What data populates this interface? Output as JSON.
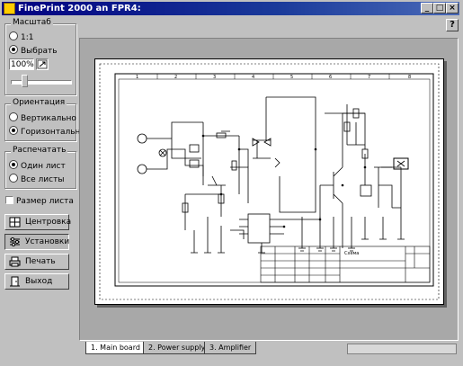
{
  "window": {
    "title": "FinePrint 2000 an FPR4:",
    "min_label": "_",
    "max_label": "□",
    "close_label": "×"
  },
  "help_label": "?",
  "scale_group": {
    "title": "Масштаб",
    "opt1": "1:1",
    "opt2": "Выбрать",
    "zoom_value": "100%",
    "selected": "opt2"
  },
  "orientation_group": {
    "title": "Ориентация",
    "opt1": "Вертикально",
    "opt2": "Горизонтально",
    "selected": "opt2"
  },
  "print_group": {
    "title": "Распечатать",
    "opt1": "Один лист",
    "opt2": "Все листы",
    "selected": "opt1"
  },
  "sheet_size_label": "Размер листа",
  "buttons": {
    "center": "Центровка",
    "settings": "Установки",
    "print": "Печать",
    "exit": "Выход"
  },
  "tabs": [
    {
      "label": "1. Main board"
    },
    {
      "label": "2. Power supply"
    },
    {
      "label": "3. Amplifier"
    }
  ],
  "drawing": {
    "col_labels": [
      "1",
      "2",
      "3",
      "4",
      "5",
      "6",
      "7",
      "8"
    ],
    "title_name": "Схема"
  },
  "colors": {
    "title_bar": "#000080",
    "face": "#c0c0c0"
  }
}
